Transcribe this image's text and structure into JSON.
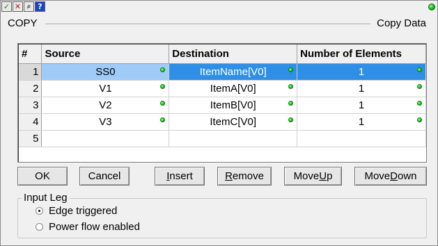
{
  "header": {
    "left_label": "COPY",
    "right_label": "Copy Data"
  },
  "toolbar": {
    "icons": [
      "check-icon",
      "close-icon",
      "zoom-icon",
      "help-icon"
    ],
    "help_glyph": "?"
  },
  "status": {
    "led_color": "#10b010"
  },
  "table": {
    "columns": [
      "#",
      "Source",
      "Destination",
      "Number of Elements"
    ],
    "rows": [
      {
        "num": "1",
        "source": "SS0",
        "destination": "ItemName[V0]",
        "count": "1",
        "selected": true
      },
      {
        "num": "2",
        "source": "V1",
        "destination": "ItemA[V0]",
        "count": "1"
      },
      {
        "num": "3",
        "source": "V2",
        "destination": "ItemB[V0]",
        "count": "1"
      },
      {
        "num": "4",
        "source": "V3",
        "destination": "ItemC[V0]",
        "count": "1"
      },
      {
        "num": "5",
        "source": "",
        "destination": "",
        "count": ""
      }
    ],
    "selection_colors": {
      "source_cell": "#9ecbf7",
      "other_cells": "#2f8fe6"
    }
  },
  "buttons": {
    "ok": "OK",
    "cancel": "Cancel",
    "insert": "Insert",
    "remove": "Remove",
    "move_up": "Move Up",
    "move_down": "Move Down"
  },
  "input_leg": {
    "title": "Input Leg",
    "options": [
      "Edge triggered",
      "Power flow enabled"
    ],
    "selected": "Edge triggered"
  }
}
